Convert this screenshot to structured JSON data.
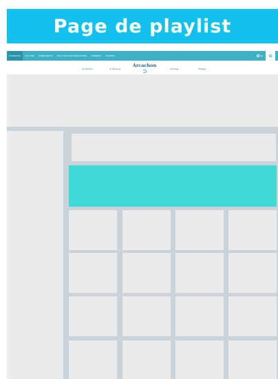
{
  "banner": {
    "title": "Page de playlist"
  },
  "navbar": {
    "items": [
      {
        "label": "Panorama",
        "active": true
      },
      {
        "label": "Culture",
        "active": false
      },
      {
        "label": "Evénements",
        "active": false
      },
      {
        "label": "Pelouses des réservoirs",
        "active": false
      },
      {
        "label": "Membres",
        "active": false
      },
      {
        "label": "Sorties",
        "active": false
      }
    ],
    "lang": "EN",
    "icons": [
      "globe-icon",
      "search-icon"
    ]
  },
  "subnav": {
    "links": [
      "Je rejoindre",
      "Je découvre",
      "Je bouge",
      "Pratique"
    ],
    "logo": {
      "brand": "Arcachon",
      "tagline": "à vivre et à aimer"
    }
  },
  "colors": {
    "banner": "#13c0ee",
    "navbar": "#3fb1c6",
    "player": "#3fdad8",
    "placeholder": "#ebebeb",
    "gutter": "#cad3da"
  },
  "grid": {
    "rows": 4,
    "cols": 4
  }
}
